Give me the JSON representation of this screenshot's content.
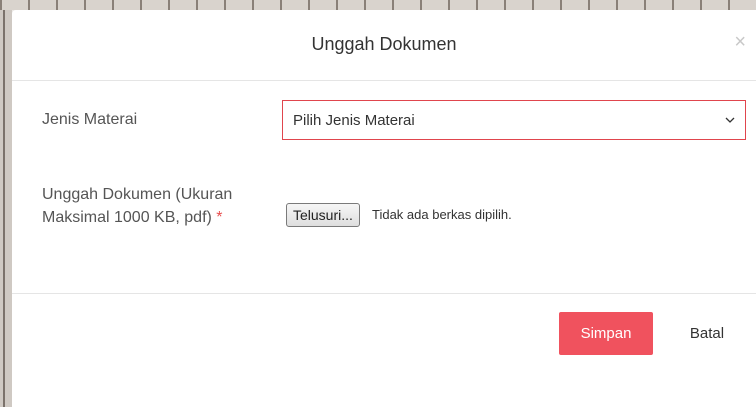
{
  "modal": {
    "title": "Unggah Dokumen",
    "close_icon": "×"
  },
  "form": {
    "jenis_materai": {
      "label": "Jenis Materai",
      "selected_value": "Pilih Jenis Materai"
    },
    "unggah_dokumen": {
      "label": "Unggah Dokumen (Ukuran Maksimal 1000 KB, pdf)",
      "required_marker": "*",
      "browse_label": "Telusuri...",
      "file_status": "Tidak ada berkas dipilih."
    }
  },
  "footer": {
    "save_label": "Simpan",
    "cancel_label": "Batal"
  },
  "colors": {
    "accent": "#f0525e",
    "select_border": "#e0454d",
    "required": "#e74c4c"
  }
}
